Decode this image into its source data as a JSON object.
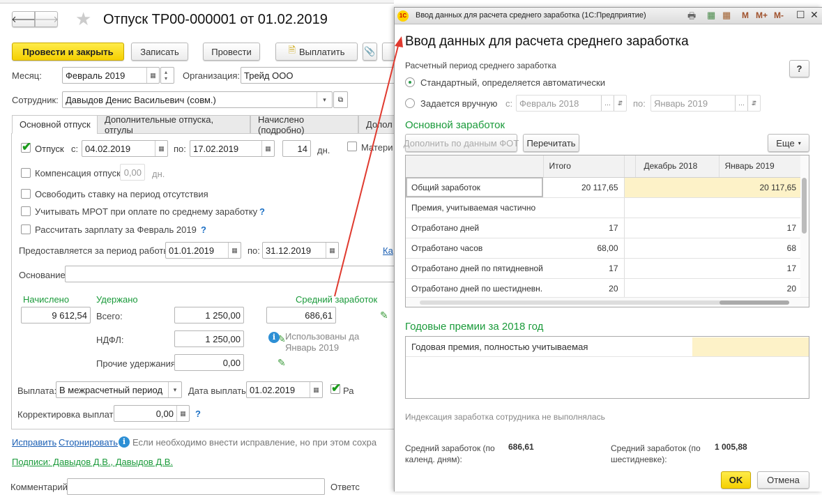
{
  "doc": {
    "title": "Отпуск ТР00-000001 от 01.02.2019",
    "toolbar": {
      "post_close": "Провести и закрыть",
      "save": "Записать",
      "post": "Провести",
      "pay": "Выплатить"
    },
    "month": {
      "label": "Месяц:",
      "value": "Февраль 2019"
    },
    "org": {
      "label": "Организация:",
      "value": "Трейд ООО"
    },
    "employee": {
      "label": "Сотрудник:",
      "value": "Давыдов Денис Васильевич (совм.)"
    },
    "tabs": [
      "Основной отпуск",
      "Дополнительные отпуска, отгулы",
      "Начислено (подробно)",
      "Допол"
    ],
    "vacation": {
      "label": "Отпуск",
      "from_label": "с:",
      "from": "04.02.2019",
      "to_label": "по:",
      "to": "17.02.2019",
      "days": "14",
      "days_unit": "дн.",
      "maternity": "Матери"
    },
    "compensation": {
      "label": "Компенсация отпуска",
      "value": "0,00",
      "unit": "дн."
    },
    "free_rate": "Освободить ставку на период отсутствия",
    "mrot": "Учитывать МРОТ при оплате по среднему заработку",
    "calc_salary": "Рассчитать зарплату за Февраль 2019",
    "help": "?",
    "period": {
      "label": "Предоставляется за период работы с:",
      "from": "01.01.2019",
      "to_label": "по:",
      "to": "31.12.2019",
      "link": "Ка"
    },
    "basis": {
      "label": "Основание:",
      "value": ""
    },
    "accrued": {
      "label": "Начислено",
      "value": "9 612,54"
    },
    "withheld": {
      "label": "Удержано",
      "total_label": "Всего:",
      "total": "1 250,00",
      "ndfl_label": "НДФЛ:",
      "ndfl": "1 250,00",
      "other_label": "Прочие удержания:",
      "other": "0,00"
    },
    "avg": {
      "label": "Средний заработок",
      "value": "686,61",
      "note1": "Использованы да",
      "note2": "Январь 2019"
    },
    "payout": {
      "label": "Выплата:",
      "value": "В межрасчетный период",
      "date_label": "Дата выплаты:",
      "date": "01.02.2019",
      "check_label": "Ра"
    },
    "correction": {
      "label": "Корректировка выплаты:",
      "value": "0,00"
    },
    "fix_link": "Исправить",
    "storno_link": "Сторнировать",
    "fix_note": "Если необходимо внести исправление, но при этом сохра",
    "signatures": "Подписи: Давыдов Д.В., Давыдов Д.В.",
    "comment": {
      "label": "Комментарий:",
      "value": "",
      "resp": "Ответс"
    }
  },
  "dialog": {
    "window_title": "Ввод данных для расчета среднего заработка  (1С:Предприятие)",
    "window_buttons": {
      "m": "M",
      "mplus": "M+",
      "mminus": "M-"
    },
    "heading": "Ввод данных для расчета среднего заработка",
    "period_label": "Расчетный период среднего заработка",
    "help": "?",
    "radio_auto": "Стандартный, определяется автоматически",
    "radio_manual": "Задается вручную",
    "from_label": "с:",
    "from": "Февраль 2018",
    "to_label": "по:",
    "to": "Январь 2019",
    "main_section": "Основной заработок",
    "fill_btn": "Дополнить по данным ФОТ",
    "reread_btn": "Перечитать",
    "more_btn": "Еще",
    "columns": [
      "",
      "Итого",
      "",
      "Декабрь 2018",
      "Январь 2019"
    ],
    "rows": [
      {
        "name": "Общий заработок",
        "total": "20 117,65",
        "dec": "",
        "jan": "20 117,65"
      },
      {
        "name": "Премия, учитываемая частично",
        "total": "",
        "dec": "",
        "jan": ""
      },
      {
        "name": "Отработано дней",
        "total": "17",
        "dec": "",
        "jan": "17"
      },
      {
        "name": "Отработано часов",
        "total": "68,00",
        "dec": "",
        "jan": "68"
      },
      {
        "name": "Отработано дней по пятидневной...",
        "total": "17",
        "dec": "",
        "jan": "17"
      },
      {
        "name": "Отработано дней по шестидневн...",
        "total": "20",
        "dec": "",
        "jan": "20"
      }
    ],
    "bonus_section": "Годовые премии за 2018 год",
    "bonus_row": "Годовая премия, полностью учитываемая",
    "indexation": "Индексация заработка сотрудника не выполнялась",
    "avg_cal_label": "Средний заработок (по календ. дням):",
    "avg_cal": "686,61",
    "avg_six_label": "Средний заработок (по шестидневке):",
    "avg_six": "1 005,88",
    "ok": "OK",
    "cancel": "Отмена"
  }
}
